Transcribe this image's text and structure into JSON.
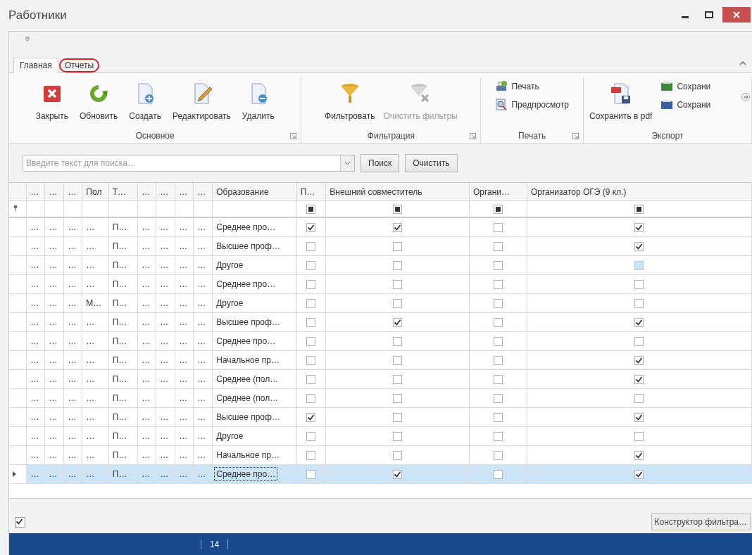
{
  "window": {
    "title": "Работники"
  },
  "tabs": [
    {
      "label": "Главная",
      "selected": true,
      "circled": false
    },
    {
      "label": "Отчеты",
      "selected": false,
      "circled": true
    }
  ],
  "ribbon": {
    "groups": [
      {
        "title": "Основное",
        "launcher": true,
        "buttons": [
          {
            "label": "Закрыть",
            "kind": "large",
            "disabled": false
          },
          {
            "label": "Обновить",
            "kind": "large",
            "disabled": false
          },
          {
            "label": "Создать",
            "kind": "large",
            "disabled": false
          },
          {
            "label": "Редактировать",
            "kind": "large",
            "disabled": false
          },
          {
            "label": "Удалить",
            "kind": "large",
            "disabled": false
          }
        ]
      },
      {
        "title": "Фильтрация",
        "launcher": true,
        "buttons": [
          {
            "label": "Фильтровать",
            "kind": "large",
            "disabled": false
          },
          {
            "label": "Очистить фильтры",
            "kind": "large",
            "disabled": true
          }
        ]
      },
      {
        "title": "Печать",
        "launcher": true,
        "buttons": [
          {
            "label": "Печать",
            "kind": "small",
            "disabled": false
          },
          {
            "label": "Предпросмотр",
            "kind": "small",
            "disabled": false
          }
        ]
      },
      {
        "title": "Экспорт",
        "launcher": false,
        "buttons": [
          {
            "label": "Сохранить в pdf",
            "kind": "large",
            "disabled": false
          },
          {
            "label": "Сохрани",
            "kind": "small",
            "disabled": false
          },
          {
            "label": "Сохрани",
            "kind": "small",
            "disabled": false
          }
        ]
      }
    ]
  },
  "search": {
    "placeholder": "Введите текст для поиска…",
    "buttons": [
      "Поиск",
      "Очистить"
    ]
  },
  "table": {
    "columns": [
      {
        "label": "…",
        "kind": "text"
      },
      {
        "label": "…",
        "kind": "text"
      },
      {
        "label": "…",
        "kind": "text"
      },
      {
        "label": "Пол",
        "kind": "text"
      },
      {
        "label": "Т…",
        "kind": "text"
      },
      {
        "label": "…",
        "kind": "text"
      },
      {
        "label": "…",
        "kind": "text"
      },
      {
        "label": "…",
        "kind": "text"
      },
      {
        "label": "…",
        "kind": "text"
      },
      {
        "label": "Образование",
        "kind": "text"
      },
      {
        "label": "П…",
        "kind": "check"
      },
      {
        "label": "Внешний совместитель",
        "kind": "check"
      },
      {
        "label": "Органи…",
        "kind": "check"
      },
      {
        "label": "Организатор ОГЭ (9 кл.)",
        "kind": "check"
      }
    ],
    "filter_indeterminate": true,
    "rows": [
      {
        "selected": false,
        "hovered": false,
        "cells": [
          "…",
          "…",
          "…",
          "…",
          "П…",
          "…",
          "…",
          "…",
          "…",
          "Среднее про…"
        ],
        "checks": [
          true,
          true,
          false,
          true
        ]
      },
      {
        "selected": false,
        "hovered": false,
        "cells": [
          "…",
          "…",
          "…",
          "…",
          "П…",
          "…",
          "…",
          "…",
          "…",
          "Высшее проф…"
        ],
        "checks": [
          false,
          false,
          false,
          true
        ]
      },
      {
        "selected": false,
        "hovered": true,
        "cells": [
          "…",
          "…",
          "…",
          "…",
          "П…",
          "…",
          "…",
          "…",
          "…",
          "Другое"
        ],
        "checks": [
          false,
          false,
          false,
          false
        ]
      },
      {
        "selected": false,
        "hovered": false,
        "cells": [
          "…",
          "…",
          "…",
          "…",
          "П…",
          "…",
          "…",
          "…",
          "…",
          "Среднее про…"
        ],
        "checks": [
          false,
          false,
          false,
          false
        ]
      },
      {
        "selected": false,
        "hovered": false,
        "cells": [
          "…",
          "…",
          "…",
          "М…",
          "П…",
          "…",
          "…",
          "…",
          "…",
          "Другое"
        ],
        "checks": [
          false,
          false,
          false,
          false
        ]
      },
      {
        "selected": false,
        "hovered": false,
        "cells": [
          "…",
          "…",
          "…",
          "…",
          "П…",
          "…",
          "…",
          "…",
          "…",
          "Высшее проф…"
        ],
        "checks": [
          false,
          true,
          false,
          true
        ]
      },
      {
        "selected": false,
        "hovered": false,
        "cells": [
          "…",
          "…",
          "…",
          "…",
          "П…",
          "…",
          "…",
          "…",
          "…",
          "Среднее про…"
        ],
        "checks": [
          false,
          false,
          false,
          false
        ]
      },
      {
        "selected": false,
        "hovered": false,
        "cells": [
          "…",
          "…",
          "…",
          "…",
          "П…",
          "…",
          "…",
          "…",
          "…",
          "Начальное пр…"
        ],
        "checks": [
          false,
          false,
          false,
          true
        ]
      },
      {
        "selected": false,
        "hovered": false,
        "cells": [
          "…",
          "…",
          "…",
          "…",
          "П…",
          "…",
          "…",
          "…",
          "…",
          "Среднее (пол…"
        ],
        "checks": [
          false,
          false,
          false,
          true
        ]
      },
      {
        "selected": false,
        "hovered": false,
        "cells": [
          "…",
          "…",
          "…",
          "…",
          "П…",
          "…",
          null,
          "…",
          "…",
          "Среднее (пол…"
        ],
        "checks": [
          false,
          false,
          false,
          false
        ]
      },
      {
        "selected": false,
        "hovered": false,
        "cells": [
          "…",
          "…",
          "…",
          "…",
          "П…",
          "…",
          "…",
          "…",
          "…",
          "Высшее проф…"
        ],
        "checks": [
          true,
          false,
          false,
          true
        ]
      },
      {
        "selected": false,
        "hovered": false,
        "cells": [
          "…",
          "…",
          "…",
          "…",
          "П…",
          "…",
          "…",
          "…",
          "…",
          "Другое"
        ],
        "checks": [
          false,
          false,
          false,
          false
        ]
      },
      {
        "selected": false,
        "hovered": false,
        "cells": [
          "…",
          "…",
          "…",
          "…",
          "П…",
          "…",
          "…",
          "…",
          "…",
          "Начальное пр…"
        ],
        "checks": [
          false,
          false,
          false,
          true
        ]
      },
      {
        "selected": true,
        "hovered": false,
        "cells": [
          "…",
          "…",
          "…",
          "…",
          "П…",
          "…",
          "…",
          "…",
          "…",
          "Среднее про…"
        ],
        "checks": [
          false,
          true,
          false,
          true
        ]
      }
    ]
  },
  "footer": {
    "filter_enabled": true,
    "filter_builder": "Конструктор фильтра…"
  },
  "status_bar": {
    "count": "14"
  }
}
